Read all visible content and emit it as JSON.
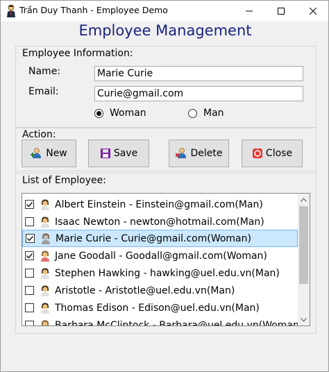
{
  "window": {
    "title": "Trần Duy Thanh - Employee Demo",
    "controls": {
      "minimize": "—",
      "maximize": "☐",
      "close": "✕"
    }
  },
  "heading": "Employee Management",
  "employee_info": {
    "group_label": "Employee Information:",
    "name_label": "Name:",
    "name_value": "Marie Curie",
    "email_label": "Email:",
    "email_value": "Curie@gmail.com",
    "gender_options": [
      {
        "label": "Woman",
        "selected": true
      },
      {
        "label": "Man",
        "selected": false
      }
    ]
  },
  "action": {
    "group_label": "Action:",
    "buttons": [
      {
        "label": "New",
        "icon": "person-add-icon"
      },
      {
        "label": "Save",
        "icon": "floppy-disk-icon"
      },
      {
        "label": "Delete",
        "icon": "person-delete-icon"
      },
      {
        "label": "Close",
        "icon": "close-icon"
      }
    ]
  },
  "employee_list": {
    "group_label": "List of Employee:",
    "items": [
      {
        "text": "Albert Einstein - Einstein@gmail.com(Man)",
        "checked": true,
        "selected": false
      },
      {
        "text": "Isaac Newton - newton@hotmail.com(Man)",
        "checked": false,
        "selected": false
      },
      {
        "text": "Marie Curie - Curie@gmail.com(Woman)",
        "checked": true,
        "selected": true
      },
      {
        "text": "Jane Goodall - Goodall@gmail.com(Woman)",
        "checked": true,
        "selected": false
      },
      {
        "text": "Stephen Hawking - hawking@uel.edu.vn(Man)",
        "checked": false,
        "selected": false
      },
      {
        "text": "Aristotle - Aristotle@uel.edu.vn(Man)",
        "checked": false,
        "selected": false
      },
      {
        "text": "Thomas Edison - Edison@uel.edu.vn(Man)",
        "checked": false,
        "selected": false
      },
      {
        "text": "Barbara McClintock - Barbara@uel.edu.vn(Woman)",
        "checked": false,
        "selected": false
      }
    ]
  },
  "colors": {
    "heading": "#1a237e",
    "selection_bg": "#cce8ff",
    "selection_border": "#7eb4ea",
    "button_bg": "#e1e1e1",
    "window_bg": "#f0f0f0"
  }
}
